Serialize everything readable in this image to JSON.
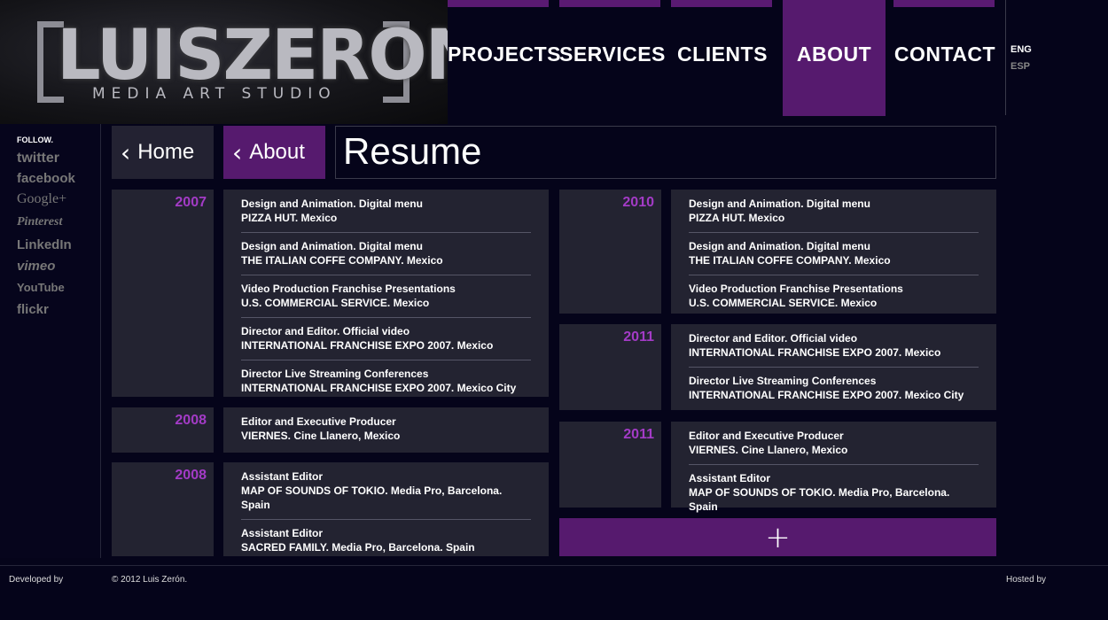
{
  "brand": {
    "name": "LUISZERON",
    "tagline": "MEDIA ART STUDIO"
  },
  "nav": [
    {
      "label": "PROJECTS"
    },
    {
      "label": "SERVICES"
    },
    {
      "label": "CLIENTS"
    },
    {
      "label": "ABOUT",
      "active": true
    },
    {
      "label": "CONTACT"
    }
  ],
  "languages": {
    "eng": "ENG",
    "esp": "ESP"
  },
  "sidebar": {
    "follow": "FOLLOW.",
    "social": [
      "twitter",
      "facebook",
      "Google+",
      "Pinterest",
      "LinkedIn",
      "vimeo",
      "YouTube",
      "flickr"
    ]
  },
  "breadcrumb": {
    "home": "Home",
    "about": "About"
  },
  "page_title": "Resume",
  "timeline": {
    "y2007": "2007",
    "e2007": [
      "Design and Animation. Digital menu\nPIZZA HUT. Mexico",
      "Design and Animation. Digital menu\nTHE ITALIAN COFFE COMPANY. Mexico",
      "Video Production Franchise Presentations\nU.S. COMMERCIAL SERVICE. Mexico",
      "Director and Editor. Official video\nINTERNATIONAL FRANCHISE EXPO 2007. Mexico",
      "Director Live Streaming Conferences\nINTERNATIONAL FRANCHISE EXPO 2007. Mexico City"
    ],
    "y2008a": "2008",
    "e2008a": [
      "Editor and Executive Producer\nVIERNES. Cine Llanero, Mexico"
    ],
    "y2008b": "2008",
    "e2008b": [
      "Assistant Editor\nMAP OF SOUNDS OF TOKIO. Media Pro, Barcelona. Spain",
      "Assistant Editor\nSACRED FAMILY. Media Pro, Barcelona. Spain"
    ],
    "y2010": "2010",
    "e2010": [
      "Design and Animation. Digital menu\nPIZZA HUT. Mexico",
      "Design and Animation. Digital menu\nTHE ITALIAN COFFE COMPANY. Mexico",
      "Video Production Franchise Presentations\nU.S. COMMERCIAL SERVICE. Mexico"
    ],
    "y2011a": "2011",
    "e2011a": [
      "Director and Editor. Official video\nINTERNATIONAL FRANCHISE EXPO 2007. Mexico",
      "Director Live Streaming Conferences\nINTERNATIONAL FRANCHISE EXPO 2007. Mexico City"
    ],
    "y2011b": "2011",
    "e2011b": [
      "Editor and Executive Producer\nVIERNES. Cine Llanero, Mexico",
      "Assistant Editor\nMAP OF SOUNDS OF TOKIO. Media Pro, Barcelona. Spain"
    ]
  },
  "more_button": "+",
  "footer": {
    "developed": "Developed by",
    "copyright": "© 2012 Luis Zerón.",
    "hosted": "Hosted by"
  },
  "colors": {
    "accent": "#561a6e",
    "year": "#a33bc6",
    "panel": "#232331",
    "bg": "#05041a"
  }
}
